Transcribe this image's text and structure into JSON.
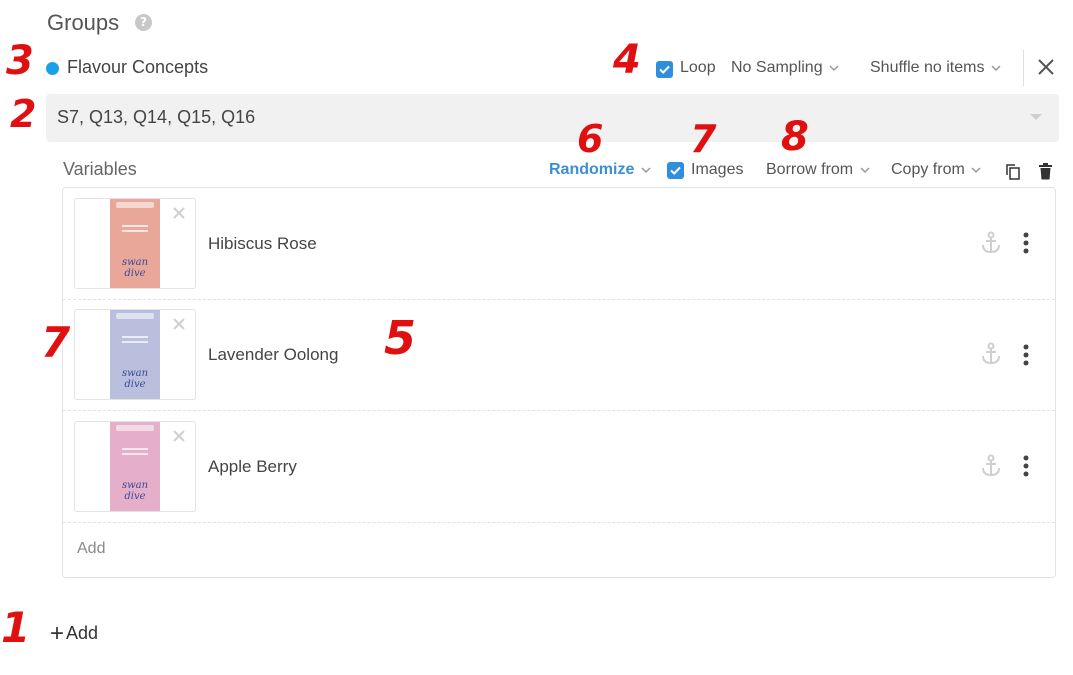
{
  "header": {
    "title": "Groups",
    "help_icon": "?"
  },
  "group": {
    "name": "Flavour Concepts",
    "dot_color": "#1aa0e8",
    "loop_label": "Loop",
    "loop_checked": true,
    "sampling": "No Sampling",
    "shuffle": "Shuffle no items"
  },
  "variables_select": {
    "value": "S7, Q13, Q14, Q15, Q16"
  },
  "toolbar": {
    "variables_label": "Variables",
    "randomize": "Randomize",
    "images_label": "Images",
    "images_checked": true,
    "borrow_from": "Borrow from",
    "copy_from": "Copy from"
  },
  "items": [
    {
      "name": "Hibiscus Rose",
      "can_color": "#e9a79a",
      "can_text": "swan dive"
    },
    {
      "name": "Lavender Oolong",
      "can_color": "#b9bfdc",
      "can_text": "swan dive"
    },
    {
      "name": "Apple Berry",
      "can_color": "#e5aec9",
      "can_text": "swan dive"
    }
  ],
  "add_inline": "Add",
  "add_bottom": "Add",
  "annotations": {
    "a1": "1",
    "a2": "2",
    "a3": "3",
    "a4": "4",
    "a5": "5",
    "a6": "6",
    "a7_top": "7",
    "a7_left": "7",
    "a8": "8"
  },
  "colors": {
    "accent": "#2f8fdd",
    "annotation": "#e01010",
    "link_blue": "#3b8fd4"
  }
}
